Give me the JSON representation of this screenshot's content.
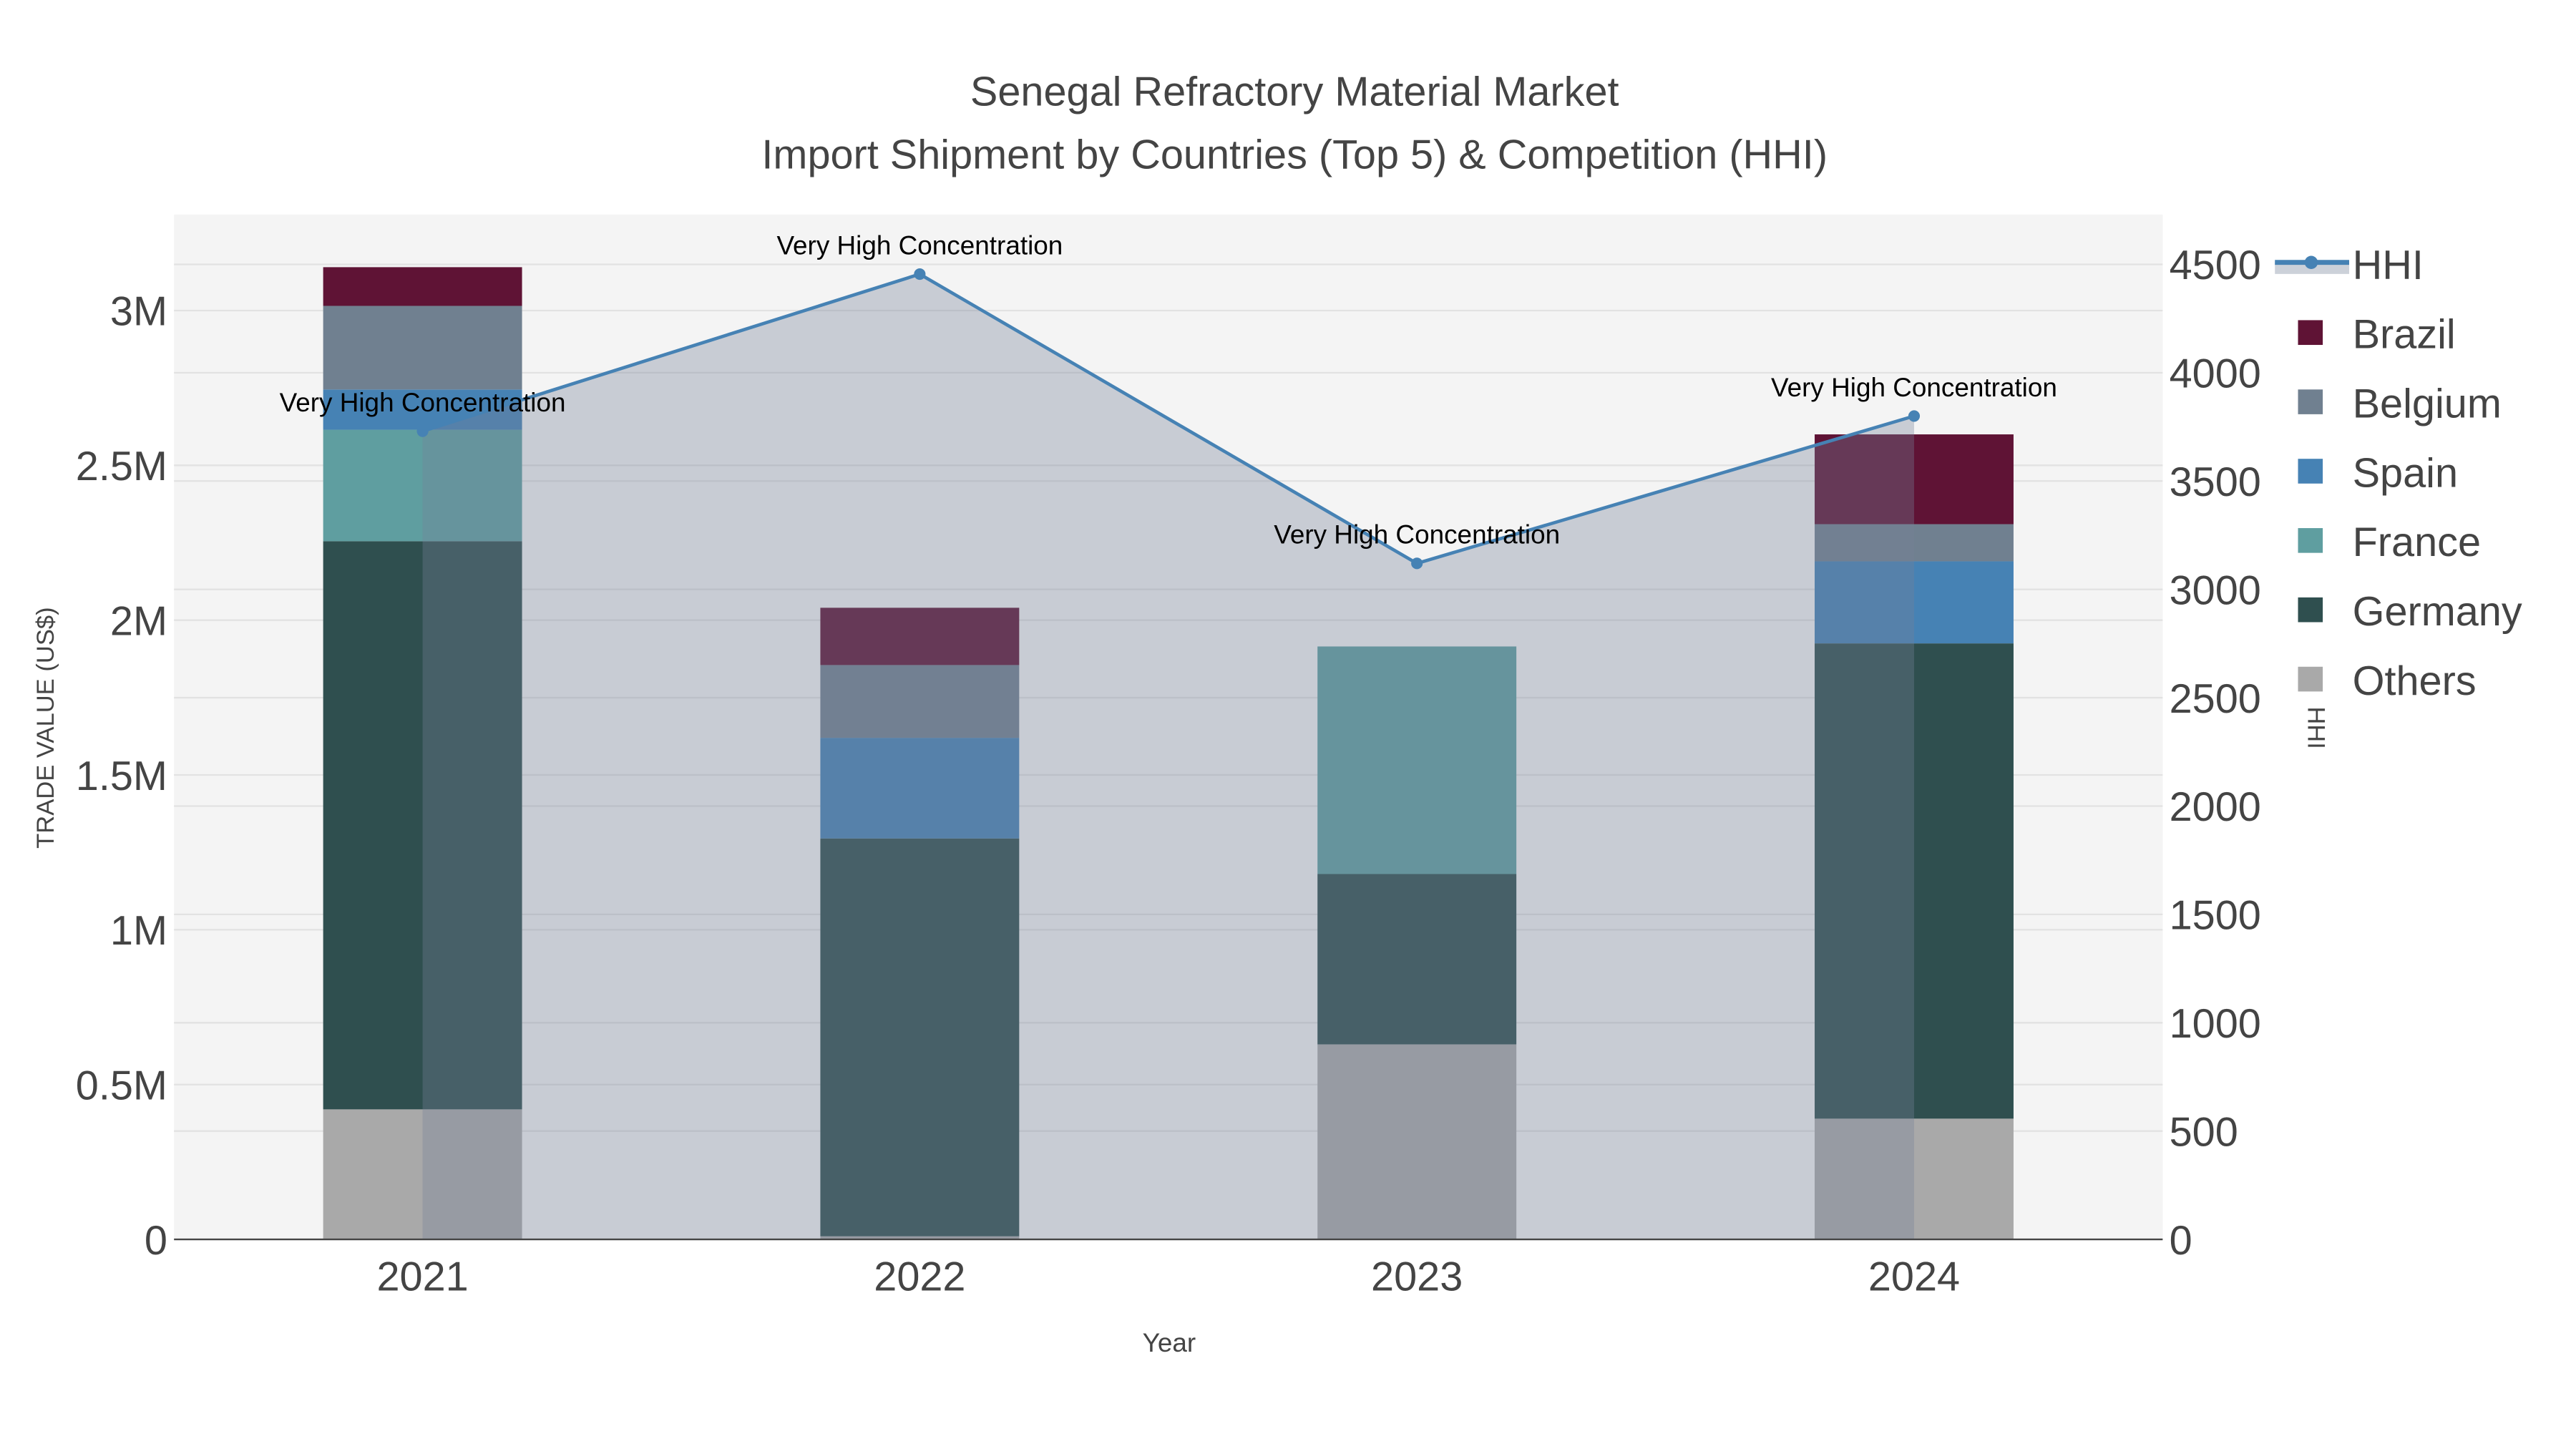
{
  "chart_data": {
    "type": "bar",
    "title_line1": "Senegal Refractory Material Market",
    "title_line2": "Import Shipment by Countries (Top 5) & Competition (HHI)",
    "xlabel": "Year",
    "ylabel": "TRADE VALUE (US$)",
    "y2label": "HHI",
    "barmode": "stack",
    "categories": [
      "2021",
      "2022",
      "2023",
      "2024"
    ],
    "ylim": [
      0,
      3310000
    ],
    "y2lim": [
      0,
      4730
    ],
    "yticks": [
      {
        "v": 0,
        "label": "0"
      },
      {
        "v": 500000,
        "label": "0.5M"
      },
      {
        "v": 1000000,
        "label": "1M"
      },
      {
        "v": 1500000,
        "label": "1.5M"
      },
      {
        "v": 2000000,
        "label": "2M"
      },
      {
        "v": 2500000,
        "label": "2.5M"
      },
      {
        "v": 3000000,
        "label": "3M"
      }
    ],
    "y2ticks": [
      0,
      500,
      1000,
      1500,
      2000,
      2500,
      3000,
      3500,
      4000,
      4500
    ],
    "grid": true,
    "legend_placement": "right",
    "series": [
      {
        "name": "Others",
        "color": "#a9a9a9",
        "values": [
          420000,
          10000,
          630000,
          390000
        ]
      },
      {
        "name": "Germany",
        "color": "#2f4f4f",
        "values": [
          1835000,
          1285000,
          550000,
          1535000
        ]
      },
      {
        "name": "France",
        "color": "#5f9ea0",
        "values": [
          360000,
          0,
          735000,
          0
        ]
      },
      {
        "name": "Spain",
        "color": "#4682b4",
        "values": [
          130000,
          325000,
          0,
          265000
        ]
      },
      {
        "name": "Belgium",
        "color": "#708090",
        "values": [
          270000,
          235000,
          0,
          120000
        ]
      },
      {
        "name": "Brazil",
        "color": "#5f1335",
        "values": [
          125000,
          185000,
          0,
          290000
        ]
      }
    ],
    "line_series": {
      "name": "HHI",
      "axis": "right",
      "color": "#4682b4",
      "fill": "rgba(118,130,152,0.35)",
      "values": [
        3730,
        4455,
        3120,
        3800
      ],
      "annotations": [
        "Very High Concentration",
        "Very High Concentration",
        "Very High Concentration",
        "Very High Concentration"
      ]
    },
    "legend_order": [
      "HHI",
      "Brazil",
      "Belgium",
      "Spain",
      "France",
      "Germany",
      "Others"
    ]
  }
}
